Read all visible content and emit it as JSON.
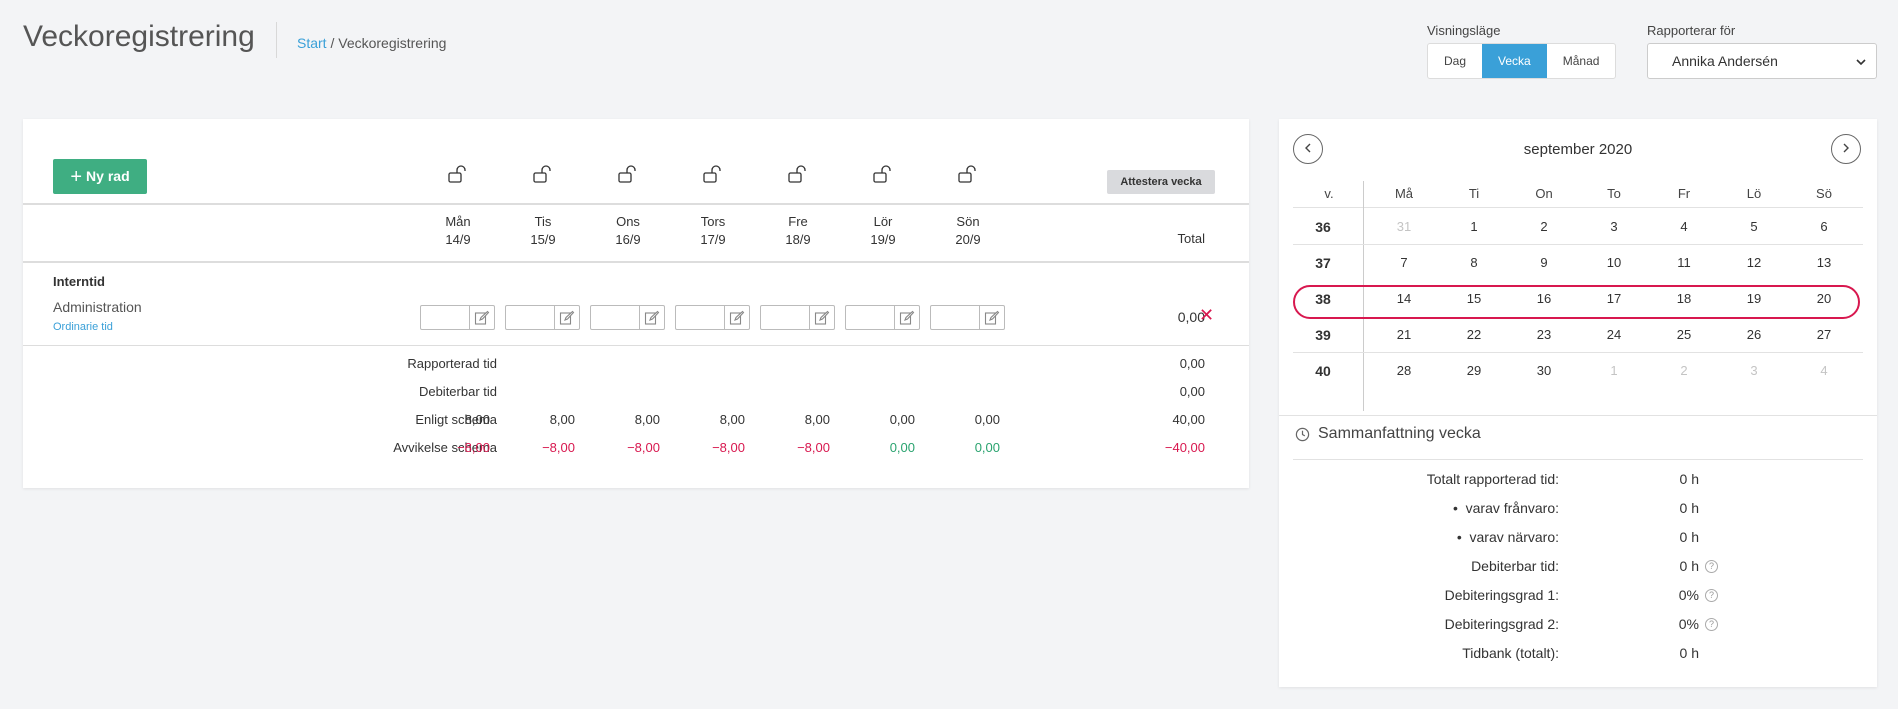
{
  "header": {
    "title": "Veckoregistrering",
    "breadcrumb_home": "Start",
    "breadcrumb_sep": "/",
    "breadcrumb_current": "Veckoregistrering",
    "view_label": "Visningsläge",
    "view_options": [
      "Dag",
      "Vecka",
      "Månad"
    ],
    "view_active": "Vecka",
    "report_for_label": "Rapporterar för",
    "report_for_value": "Annika Andersén"
  },
  "toolbar": {
    "new_row_label": "Ny rad",
    "attest_label": "Attestera vecka"
  },
  "days": [
    {
      "name": "Mån",
      "date": "14/9",
      "schema": "8,00",
      "deviation": "−8,00",
      "dev_type": "neg"
    },
    {
      "name": "Tis",
      "date": "15/9",
      "schema": "8,00",
      "deviation": "−8,00",
      "dev_type": "neg"
    },
    {
      "name": "Ons",
      "date": "16/9",
      "schema": "8,00",
      "deviation": "−8,00",
      "dev_type": "neg"
    },
    {
      "name": "Tors",
      "date": "17/9",
      "schema": "8,00",
      "deviation": "−8,00",
      "dev_type": "neg"
    },
    {
      "name": "Fre",
      "date": "18/9",
      "schema": "8,00",
      "deviation": "−8,00",
      "dev_type": "neg"
    },
    {
      "name": "Lör",
      "date": "19/9",
      "schema": "0,00",
      "deviation": "0,00",
      "dev_type": "pos"
    },
    {
      "name": "Sön",
      "date": "20/9",
      "schema": "0,00",
      "deviation": "0,00",
      "dev_type": "pos"
    }
  ],
  "table": {
    "total_header": "Total",
    "section": "Interntid",
    "project_name": "Administration",
    "project_sub": "Ordinarie tid",
    "row_total": "0,00"
  },
  "summary_rows": {
    "reported_label": "Rapporterad tid",
    "reported_total": "0,00",
    "billable_label": "Debiterbar tid",
    "billable_total": "0,00",
    "schema_label": "Enligt schema",
    "schema_total": "40,00",
    "deviation_label": "Avvikelse schema",
    "deviation_total": "−40,00"
  },
  "calendar": {
    "title": "september 2020",
    "week_header": "v.",
    "weekdays": [
      "Må",
      "Ti",
      "On",
      "To",
      "Fr",
      "Lö",
      "Sö"
    ],
    "weeks": [
      {
        "week": "36",
        "days": [
          "31",
          "1",
          "2",
          "3",
          "4",
          "5",
          "6"
        ],
        "muted": [
          true,
          false,
          false,
          false,
          false,
          false,
          false
        ]
      },
      {
        "week": "37",
        "days": [
          "7",
          "8",
          "9",
          "10",
          "11",
          "12",
          "13"
        ],
        "muted": [
          false,
          false,
          false,
          false,
          false,
          false,
          false
        ]
      },
      {
        "week": "38",
        "days": [
          "14",
          "15",
          "16",
          "17",
          "18",
          "19",
          "20"
        ],
        "muted": [
          false,
          false,
          false,
          false,
          false,
          false,
          false
        ]
      },
      {
        "week": "39",
        "days": [
          "21",
          "22",
          "23",
          "24",
          "25",
          "26",
          "27"
        ],
        "muted": [
          false,
          false,
          false,
          false,
          false,
          false,
          false
        ]
      },
      {
        "week": "40",
        "days": [
          "28",
          "29",
          "30",
          "1",
          "2",
          "3",
          "4"
        ],
        "muted": [
          false,
          false,
          false,
          true,
          true,
          true,
          true
        ]
      }
    ],
    "selected_week": "38"
  },
  "week_summary": {
    "title": "Sammanfattning vecka",
    "rows": [
      {
        "label": "Totalt rapporterad tid:",
        "value": "0 h",
        "help": false,
        "bullet": false
      },
      {
        "label": "varav frånvaro:",
        "value": "0 h",
        "help": false,
        "bullet": true
      },
      {
        "label": "varav närvaro:",
        "value": "0 h",
        "help": false,
        "bullet": true
      },
      {
        "label": "Debiterbar tid:",
        "value": "0 h",
        "help": true,
        "bullet": false
      },
      {
        "label": "Debiteringsgrad 1:",
        "value": "0%",
        "help": true,
        "bullet": false
      },
      {
        "label": "Debiteringsgrad 2:",
        "value": "0%",
        "help": true,
        "bullet": false
      },
      {
        "label": "Tidbank (totalt):",
        "value": "0 h",
        "help": false,
        "bullet": false
      }
    ]
  },
  "colors": {
    "accent": "#3aa0d8",
    "primary_button": "#3fae82",
    "negative": "#d8184f",
    "positive": "#2aa36f"
  }
}
